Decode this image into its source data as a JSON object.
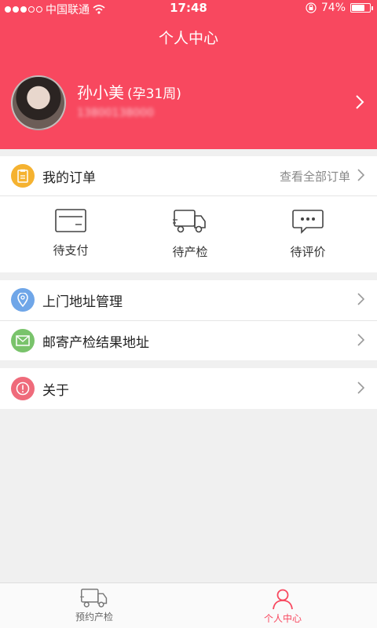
{
  "status_bar": {
    "carrier": "中国联通",
    "time": "17:48",
    "battery": "74%",
    "battery_level": 0.74
  },
  "header": {
    "title": "个人中心"
  },
  "profile": {
    "name": "孙小美",
    "pregnancy_week": "(孕31周)",
    "phone": "13800138000"
  },
  "orders": {
    "title": "我的订单",
    "view_all": "查看全部订单",
    "tabs": [
      {
        "label": "待支付",
        "icon": "card-icon"
      },
      {
        "label": "待产检",
        "icon": "truck-icon"
      },
      {
        "label": "待评价",
        "icon": "chat-icon"
      }
    ]
  },
  "address_menu": {
    "items": [
      {
        "label": "上门地址管理",
        "icon": "location-icon",
        "color": "#6fa6e8"
      },
      {
        "label": "邮寄产检结果地址",
        "icon": "mail-icon",
        "color": "#79c36b"
      }
    ]
  },
  "about": {
    "label": "关于",
    "icon": "info-icon",
    "color": "#ef6b7b"
  },
  "tab_bar": {
    "items": [
      {
        "label": "预约产检",
        "icon": "truck-icon",
        "active": false
      },
      {
        "label": "个人中心",
        "icon": "person-icon",
        "active": true
      }
    ],
    "active_color": "#f8485f"
  },
  "colors": {
    "brand": "#f8485f",
    "order_icon": "#f5b230"
  }
}
